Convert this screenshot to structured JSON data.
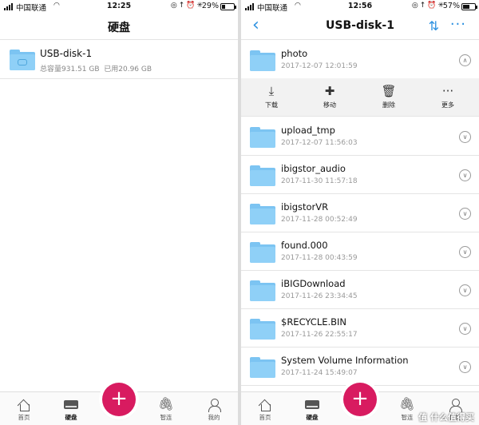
{
  "left": {
    "status": {
      "carrier": "中国联通",
      "time": "12:25",
      "battery": "29%",
      "battery_level": 0.29
    },
    "nav": {
      "title": "硬盘"
    },
    "disk": {
      "name": "USB-disk-1",
      "capacity": "总容量931.51 GB",
      "used": "已用20.96 GB"
    }
  },
  "right": {
    "status": {
      "carrier": "中国联通",
      "time": "12:56",
      "battery": "57%",
      "battery_level": 0.57
    },
    "nav": {
      "title": "USB-disk-1",
      "back_icon": "back-chevron-icon",
      "sort_icon": "sort-icon",
      "more_icon": "more-icon"
    },
    "actions": [
      {
        "label": "下载",
        "icon": "download-icon"
      },
      {
        "label": "移动",
        "icon": "move-icon"
      },
      {
        "label": "删除",
        "icon": "trash-icon"
      },
      {
        "label": "更多",
        "icon": "more-icon"
      }
    ],
    "files": [
      {
        "name": "photo",
        "date": "2017-12-07 12:01:59",
        "expanded": true
      },
      {
        "name": "upload_tmp",
        "date": "2017-12-07 11:56:03",
        "expanded": false
      },
      {
        "name": "ibigstor_audio",
        "date": "2017-11-30 11:57:18",
        "expanded": false
      },
      {
        "name": "ibigstorVR",
        "date": "2017-11-28 00:52:49",
        "expanded": false
      },
      {
        "name": "found.000",
        "date": "2017-11-28 00:43:59",
        "expanded": false
      },
      {
        "name": "iBIGDownload",
        "date": "2017-11-26 23:34:45",
        "expanded": false
      },
      {
        "name": "$RECYCLE.BIN",
        "date": "2017-11-26 22:55:17",
        "expanded": false
      },
      {
        "name": "System Volume Information",
        "date": "2017-11-24 15:49:07",
        "expanded": false
      }
    ]
  },
  "tabbar": {
    "items": [
      {
        "label": "首页",
        "icon": "home-icon"
      },
      {
        "label": "硬盘",
        "icon": "hard-disk-icon",
        "active": true
      },
      {
        "label": "",
        "icon": "plus-icon"
      },
      {
        "label": "智连",
        "icon": "paperclip-icon"
      },
      {
        "label": "我的",
        "icon": "user-icon"
      }
    ]
  },
  "watermark": "值 什么值得买",
  "colors": {
    "accent": "#2b90e0",
    "fab": "#d81b60",
    "folder": "#8fd0f7"
  }
}
